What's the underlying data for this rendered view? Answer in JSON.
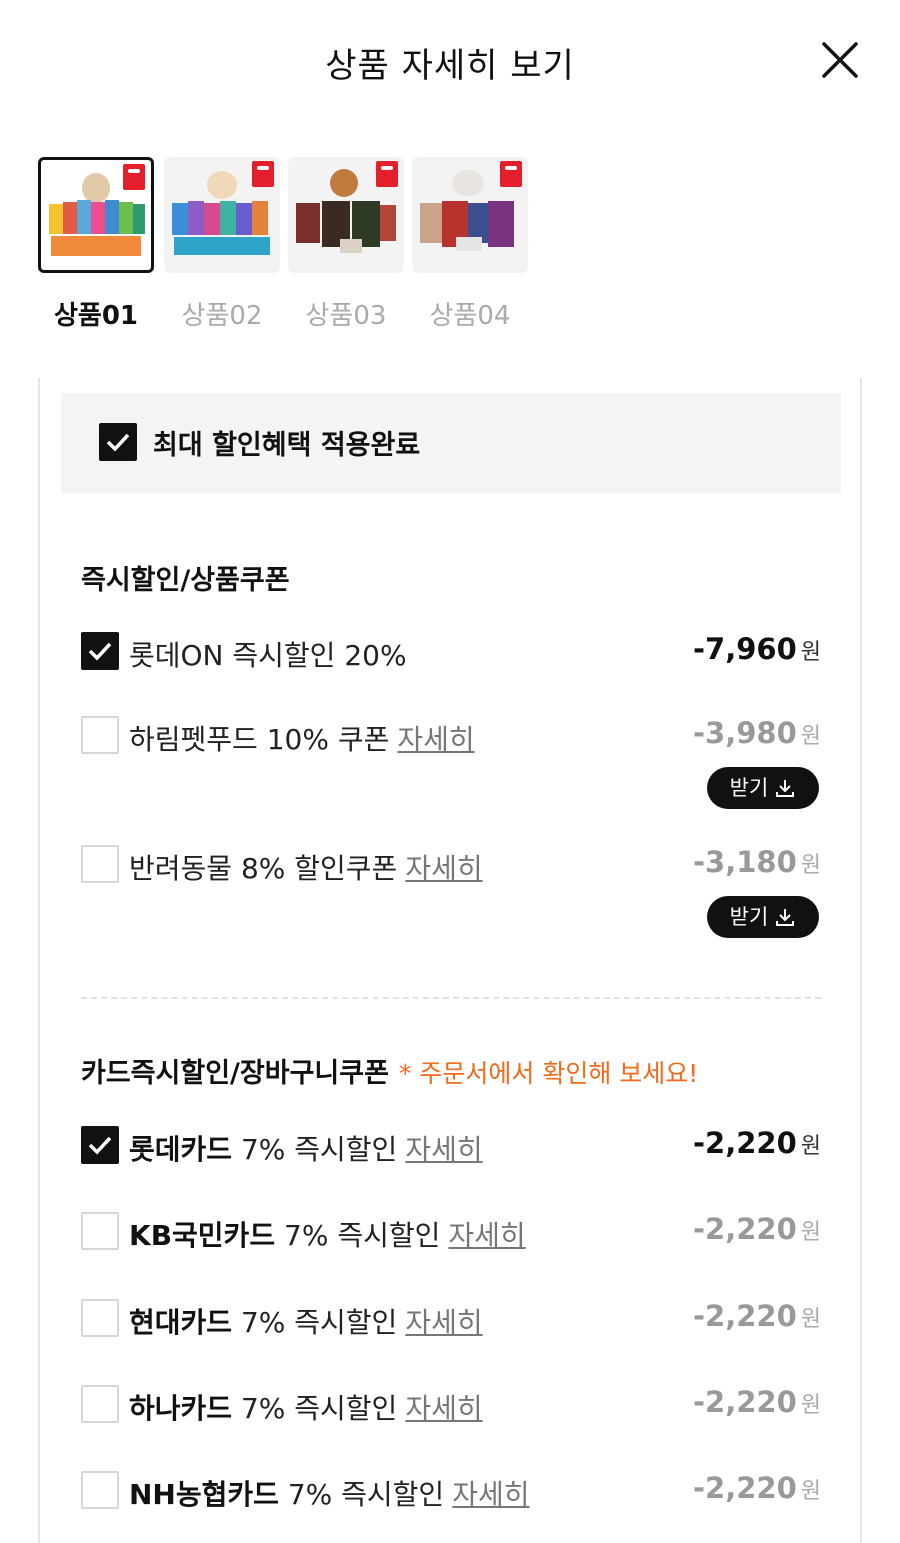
{
  "header": {
    "title": "상품 자세히 보기"
  },
  "thumbnails": [
    {
      "label": "상품01",
      "active": true
    },
    {
      "label": "상품02",
      "active": false
    },
    {
      "label": "상품03",
      "active": false
    },
    {
      "label": "상품04",
      "active": false
    }
  ],
  "max_benefit": {
    "label": "최대 할인혜택 적용완료",
    "checked": true
  },
  "instant_section": {
    "title": "즉시할인/상품쿠폰",
    "items": [
      {
        "label": "롯데ON 즉시할인 20%",
        "amount": "-7,960",
        "unit": "원",
        "checked": true
      },
      {
        "label": "하림펫푸드 10% 쿠폰",
        "detail": "자세히",
        "amount": "-3,980",
        "unit": "원",
        "checked": false,
        "button": "받기"
      },
      {
        "label": "반려동물 8% 할인쿠폰",
        "detail": "자세히",
        "amount": "-3,180",
        "unit": "원",
        "checked": false,
        "button": "받기"
      }
    ]
  },
  "card_section": {
    "title": "카드즉시할인/장바구니쿠폰",
    "note": "* 주문서에서 확인해 보세요!",
    "items": [
      {
        "name": "롯데카드",
        "label": "7% 즉시할인",
        "detail": "자세히",
        "amount": "-2,220",
        "unit": "원",
        "checked": true
      },
      {
        "name": "KB국민카드",
        "label": "7% 즉시할인",
        "detail": "자세히",
        "amount": "-2,220",
        "unit": "원",
        "checked": false
      },
      {
        "name": "현대카드",
        "label": "7% 즉시할인",
        "detail": "자세히",
        "amount": "-2,220",
        "unit": "원",
        "checked": false
      },
      {
        "name": "하나카드",
        "label": "7% 즉시할인",
        "detail": "자세히",
        "amount": "-2,220",
        "unit": "원",
        "checked": false
      },
      {
        "name": "NH농협카드",
        "label": "7% 즉시할인",
        "detail": "자세히",
        "amount": "-2,220",
        "unit": "원",
        "checked": false
      }
    ]
  },
  "colors": {
    "accent_note": "#f26a1b",
    "badge_red": "#e41e2b",
    "checkbox_checked": "#111111"
  }
}
